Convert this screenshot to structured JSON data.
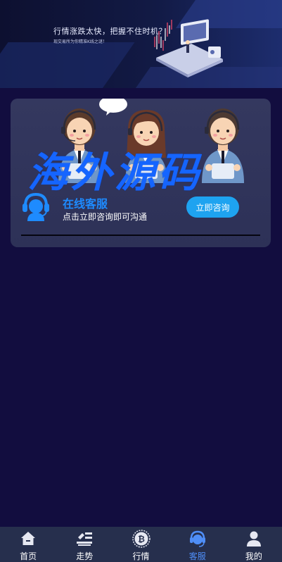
{
  "banner": {
    "title": "行情涨跌太快，把握不住时机？",
    "subtitle": "现交易所为你精准K线之谜！"
  },
  "card": {
    "watermark": "海外源码",
    "service_title": "在线客服",
    "service_desc": "点击立即咨询即可沟通",
    "consult_button": "立即咨询"
  },
  "tabbar": {
    "items": [
      {
        "label": "首页",
        "icon": "home-icon"
      },
      {
        "label": "走势",
        "icon": "trend-icon"
      },
      {
        "label": "行情",
        "icon": "bitcoin-icon"
      },
      {
        "label": "客服",
        "icon": "headset-icon",
        "active": true
      },
      {
        "label": "我的",
        "icon": "user-icon"
      }
    ]
  },
  "colors": {
    "page_bg": "#120d3f",
    "accent": "#1ea3f0",
    "active_tab": "#4f8ef7",
    "service_title": "#1e8bff",
    "watermark": "#1565ff"
  }
}
